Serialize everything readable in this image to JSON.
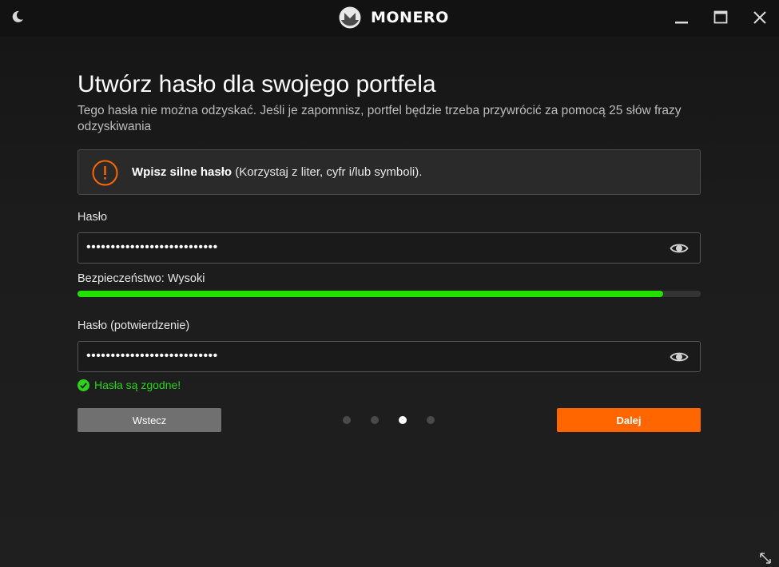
{
  "titlebar": {
    "app_name": "MONERO",
    "icons": {
      "theme": "moon-icon",
      "logo": "monero-logo-icon",
      "minimize": "minimize-icon",
      "maximize": "maximize-icon",
      "close": "close-icon"
    }
  },
  "page": {
    "title": "Utwórz hasło dla swojego portfela",
    "subtitle": "Tego hasła nie można odzyskać. Jeśli je zapomnisz, portfel będzie trzeba przywrócić za pomocą 25 słów frazy odzyskiwania"
  },
  "alert": {
    "icon": "warning-icon",
    "bold_text": "Wpisz silne hasło",
    "text": " (Korzystaj z liter, cyfr i/lub symboli)."
  },
  "password": {
    "label": "Hasło",
    "value": "•••••••••••••••••••••••••••"
  },
  "strength": {
    "label": "Bezpieczeństwo: Wysoki",
    "fraction": 0.94,
    "color": "#22e000"
  },
  "confirm": {
    "label": "Hasło (potwierdzenie)",
    "value": "•••••••••••••••••••••••••••"
  },
  "match": {
    "icon": "check-circle-icon",
    "text": "Hasła są zgodne!",
    "color": "#2ad31a"
  },
  "nav": {
    "back_label": "Wstecz",
    "next_label": "Dalej",
    "steps_total": 4,
    "active_step": 3
  },
  "colors": {
    "accent": "#ff6600",
    "background": "#1c1c1c"
  }
}
